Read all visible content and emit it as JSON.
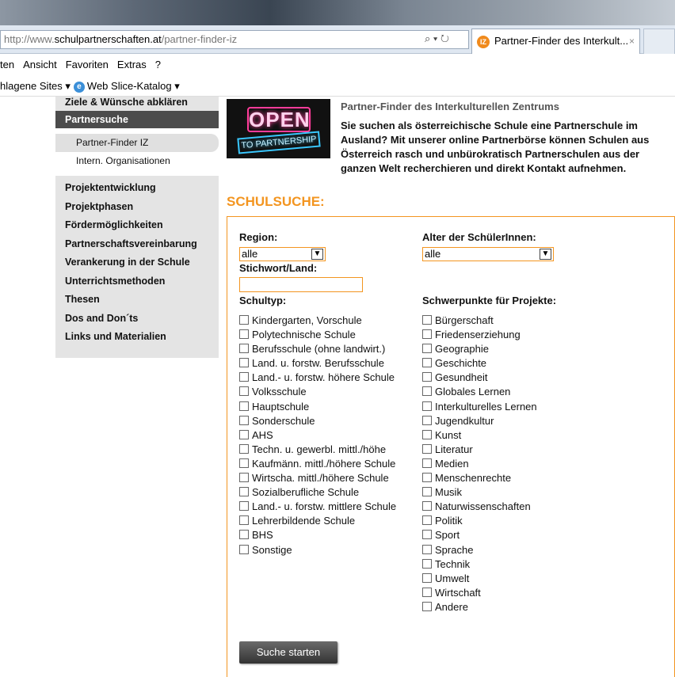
{
  "browser": {
    "url_prefix": "http://www.",
    "url_domain": "schulpartnerschaften.at",
    "url_path": "/partner-finder-iz",
    "tab_title": "Partner-Finder des Interkult...",
    "tab_close": "×",
    "menu": [
      "ten",
      "Ansicht",
      "Favoriten",
      "Extras",
      "?"
    ],
    "favorites": [
      "hlagene Sites ▾",
      "Web Slice-Katalog ▾"
    ]
  },
  "sidebar": {
    "top": "Ziele & Wünsche abklären",
    "active": "Partnersuche",
    "sub": [
      "Partner-Finder IZ",
      "Intern. Organisationen"
    ],
    "items": [
      "Projektentwicklung",
      "Projektphasen",
      "Fördermöglichkeiten",
      "Partnerschaftsvereinbarung",
      "Verankerung in der Schule",
      "Unterrichtsmethoden",
      "Thesen",
      "Dos and Don´ts",
      "Links und Materialien"
    ]
  },
  "banner": {
    "open": "OPEN",
    "partnership": "TO PARTNERSHIP"
  },
  "intro": {
    "title": "Partner-Finder des Interkulturellen Zentrums",
    "text": "Sie suchen als österreichische Schule eine Partnerschule im Ausland? Mit unserer online Partnerbörse können Schulen aus Österreich rasch und unbürokratisch Partnerschulen aus der ganzen Welt recherchieren und direkt Kontakt aufnehmen."
  },
  "search": {
    "heading": "SCHULSUCHE:",
    "region_label": "Region:",
    "region_value": "alle",
    "age_label": "Alter der SchülerInnen:",
    "age_value": "alle",
    "keyword_label": "Stichwort/Land:",
    "keyword_value": "",
    "schooltype_label": "Schultyp:",
    "focus_label": "Schwerpunkte für Projekte:",
    "schooltypes": [
      "Kindergarten, Vorschule",
      "Polytechnische Schule",
      "Berufsschule (ohne landwirt.)",
      "Land. u. forstw. Berufsschule",
      "Land.- u. forstw. höhere Schule",
      "Volksschule",
      "Hauptschule",
      "Sonderschule",
      "AHS",
      "Techn. u. gewerbl. mittl./höhe",
      "Kaufmänn. mittl./höhere Schule",
      "Wirtscha. mittl./höhere Schule",
      "Sozialberufliche Schule",
      "Land.- u. forstw. mittlere Schule",
      "Lehrerbildende Schule",
      "BHS",
      "Sonstige"
    ],
    "focus": [
      "Bürgerschaft",
      "Friedenserziehung",
      "Geographie",
      "Geschichte",
      "Gesundheit",
      "Globales Lernen",
      "Interkulturelles Lernen",
      "Jugendkultur",
      "Kunst",
      "Literatur",
      "Medien",
      "Menschenrechte",
      "Musik",
      "Naturwissenschaften",
      "Politik",
      "Sport",
      "Sprache",
      "Technik",
      "Umwelt",
      "Wirtschaft",
      "Andere"
    ],
    "button": "Suche starten"
  }
}
